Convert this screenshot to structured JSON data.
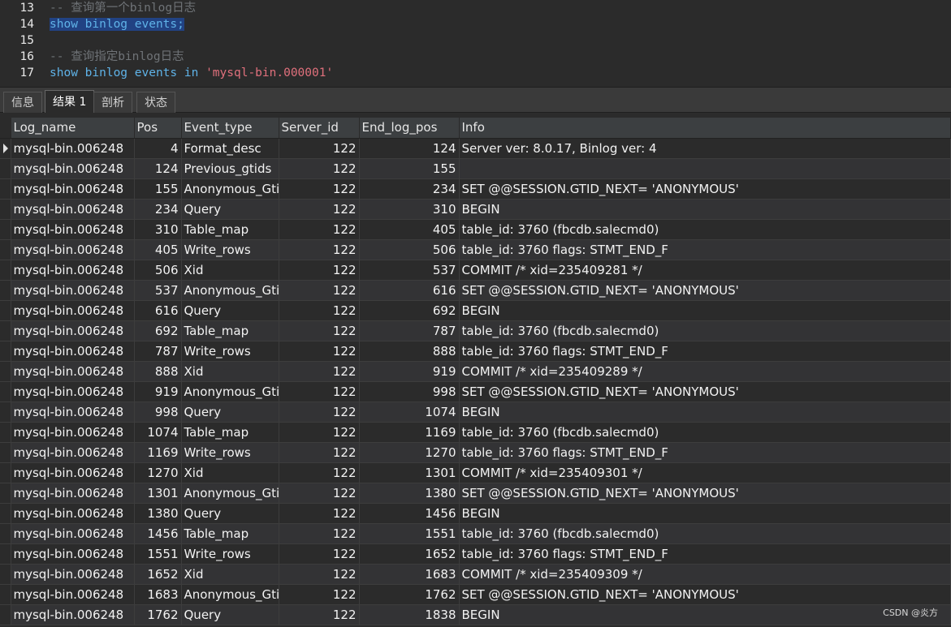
{
  "editor": {
    "lines": [
      {
        "num": "13",
        "parts": [
          {
            "t": "-- 查询第一个binlog日志",
            "c": "cmt"
          }
        ]
      },
      {
        "num": "14",
        "parts": [
          {
            "t": "show binlog events;",
            "c": "kw",
            "sel": true
          }
        ]
      },
      {
        "num": "15",
        "parts": []
      },
      {
        "num": "16",
        "parts": [
          {
            "t": "-- 查询指定binlog日志",
            "c": "cmt"
          }
        ]
      },
      {
        "num": "17",
        "parts": [
          {
            "t": "show binlog events in ",
            "c": "kw"
          },
          {
            "t": "'mysql-bin.000001'",
            "c": "str"
          }
        ]
      }
    ]
  },
  "tabs": [
    "信息",
    "结果 1",
    "剖析",
    "状态"
  ],
  "active_tab": 1,
  "grid": {
    "columns": [
      "Log_name",
      "Pos",
      "Event_type",
      "Server_id",
      "End_log_pos",
      "Info"
    ],
    "rows": [
      [
        "mysql-bin.006248",
        "4",
        "Format_desc",
        "122",
        "124",
        "Server ver: 8.0.17, Binlog ver: 4"
      ],
      [
        "mysql-bin.006248",
        "124",
        "Previous_gtids",
        "122",
        "155",
        ""
      ],
      [
        "mysql-bin.006248",
        "155",
        "Anonymous_Gtid",
        "122",
        "234",
        "SET @@SESSION.GTID_NEXT= 'ANONYMOUS'"
      ],
      [
        "mysql-bin.006248",
        "234",
        "Query",
        "122",
        "310",
        "BEGIN"
      ],
      [
        "mysql-bin.006248",
        "310",
        "Table_map",
        "122",
        "405",
        "table_id: 3760 (fbcdb.salecmd0)"
      ],
      [
        "mysql-bin.006248",
        "405",
        "Write_rows",
        "122",
        "506",
        "table_id: 3760 flags: STMT_END_F"
      ],
      [
        "mysql-bin.006248",
        "506",
        "Xid",
        "122",
        "537",
        "COMMIT /* xid=235409281 */"
      ],
      [
        "mysql-bin.006248",
        "537",
        "Anonymous_Gtid",
        "122",
        "616",
        "SET @@SESSION.GTID_NEXT= 'ANONYMOUS'"
      ],
      [
        "mysql-bin.006248",
        "616",
        "Query",
        "122",
        "692",
        "BEGIN"
      ],
      [
        "mysql-bin.006248",
        "692",
        "Table_map",
        "122",
        "787",
        "table_id: 3760 (fbcdb.salecmd0)"
      ],
      [
        "mysql-bin.006248",
        "787",
        "Write_rows",
        "122",
        "888",
        "table_id: 3760 flags: STMT_END_F"
      ],
      [
        "mysql-bin.006248",
        "888",
        "Xid",
        "122",
        "919",
        "COMMIT /* xid=235409289 */"
      ],
      [
        "mysql-bin.006248",
        "919",
        "Anonymous_Gtid",
        "122",
        "998",
        "SET @@SESSION.GTID_NEXT= 'ANONYMOUS'"
      ],
      [
        "mysql-bin.006248",
        "998",
        "Query",
        "122",
        "1074",
        "BEGIN"
      ],
      [
        "mysql-bin.006248",
        "1074",
        "Table_map",
        "122",
        "1169",
        "table_id: 3760 (fbcdb.salecmd0)"
      ],
      [
        "mysql-bin.006248",
        "1169",
        "Write_rows",
        "122",
        "1270",
        "table_id: 3760 flags: STMT_END_F"
      ],
      [
        "mysql-bin.006248",
        "1270",
        "Xid",
        "122",
        "1301",
        "COMMIT /* xid=235409301 */"
      ],
      [
        "mysql-bin.006248",
        "1301",
        "Anonymous_Gtid",
        "122",
        "1380",
        "SET @@SESSION.GTID_NEXT= 'ANONYMOUS'"
      ],
      [
        "mysql-bin.006248",
        "1380",
        "Query",
        "122",
        "1456",
        "BEGIN"
      ],
      [
        "mysql-bin.006248",
        "1456",
        "Table_map",
        "122",
        "1551",
        "table_id: 3760 (fbcdb.salecmd0)"
      ],
      [
        "mysql-bin.006248",
        "1551",
        "Write_rows",
        "122",
        "1652",
        "table_id: 3760 flags: STMT_END_F"
      ],
      [
        "mysql-bin.006248",
        "1652",
        "Xid",
        "122",
        "1683",
        "COMMIT /* xid=235409309 */"
      ],
      [
        "mysql-bin.006248",
        "1683",
        "Anonymous_Gtid",
        "122",
        "1762",
        "SET @@SESSION.GTID_NEXT= 'ANONYMOUS'"
      ],
      [
        "mysql-bin.006248",
        "1762",
        "Query",
        "122",
        "1838",
        "BEGIN"
      ]
    ]
  },
  "watermark": "CSDN @炎方"
}
